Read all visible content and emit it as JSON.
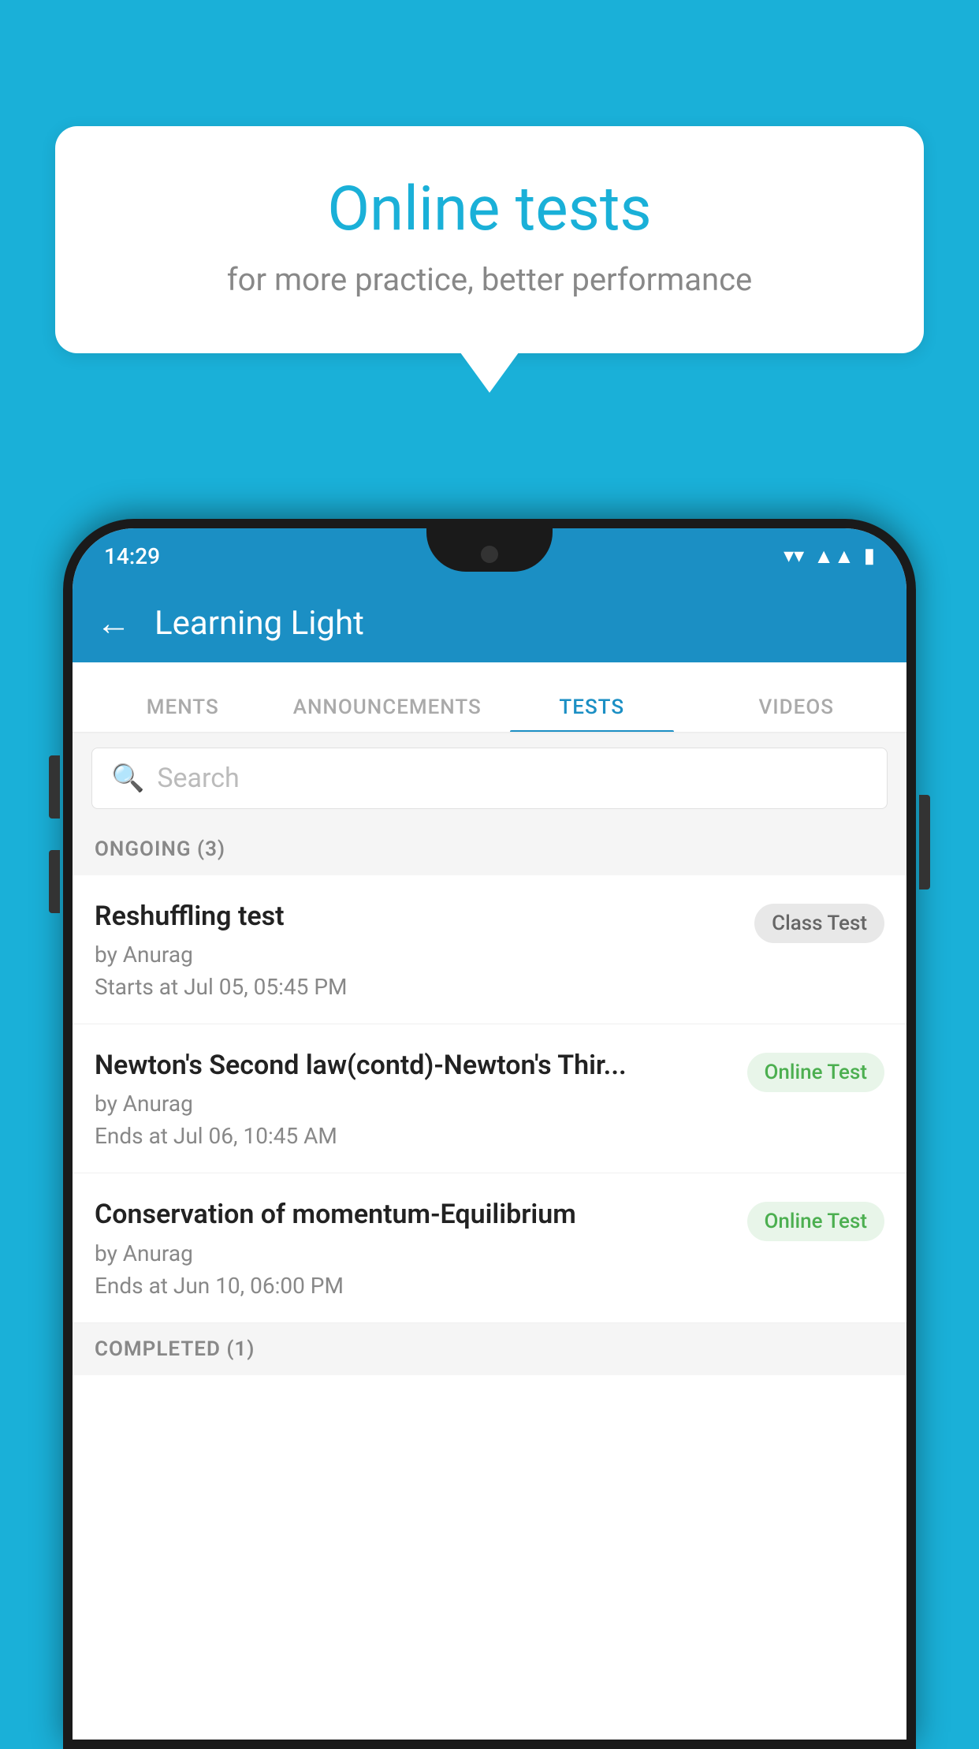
{
  "bubble": {
    "title": "Online tests",
    "subtitle": "for more practice, better performance"
  },
  "status": {
    "time": "14:29",
    "wifi": "▾",
    "signal": "◂",
    "battery": "▮"
  },
  "header": {
    "back_icon": "←",
    "title": "Learning Light"
  },
  "tabs": [
    {
      "label": "MENTS",
      "active": false
    },
    {
      "label": "ANNOUNCEMENTS",
      "active": false
    },
    {
      "label": "TESTS",
      "active": true
    },
    {
      "label": "VIDEOS",
      "active": false
    }
  ],
  "search": {
    "placeholder": "Search",
    "icon": "🔍"
  },
  "ongoing_section": {
    "label": "ONGOING (3)"
  },
  "tests": [
    {
      "name": "Reshuffling test",
      "author": "by Anurag",
      "date": "Starts at  Jul 05, 05:45 PM",
      "badge": "Class Test",
      "badge_type": "class"
    },
    {
      "name": "Newton's Second law(contd)-Newton's Thir...",
      "author": "by Anurag",
      "date": "Ends at  Jul 06, 10:45 AM",
      "badge": "Online Test",
      "badge_type": "online"
    },
    {
      "name": "Conservation of momentum-Equilibrium",
      "author": "by Anurag",
      "date": "Ends at  Jun 10, 06:00 PM",
      "badge": "Online Test",
      "badge_type": "online"
    }
  ],
  "completed_section": {
    "label": "COMPLETED (1)"
  }
}
